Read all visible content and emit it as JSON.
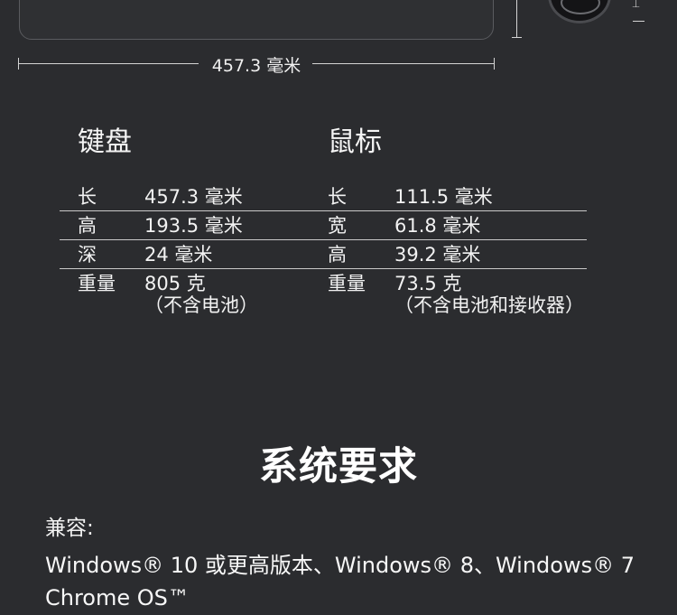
{
  "dimension": {
    "width_label": "457.3 毫米"
  },
  "keyboard": {
    "title": "键盘",
    "rows": [
      {
        "key": "长",
        "value": "457.3 毫米",
        "note": ""
      },
      {
        "key": "高",
        "value": "193.5 毫米",
        "note": ""
      },
      {
        "key": "深",
        "value": "24 毫米",
        "note": ""
      },
      {
        "key": "重量",
        "value": "805 克",
        "note": "（不含电池）"
      }
    ]
  },
  "mouse": {
    "title": "鼠标",
    "rows": [
      {
        "key": "长",
        "value": "111.5 毫米",
        "note": ""
      },
      {
        "key": "宽",
        "value": "61.8 毫米",
        "note": ""
      },
      {
        "key": "高",
        "value": "39.2 毫米",
        "note": ""
      },
      {
        "key": "重量",
        "value": "73.5 克",
        "note": "（不含电池和接收器）"
      }
    ]
  },
  "system_requirements": {
    "title": "系统要求",
    "compat_label": "兼容:",
    "line1": "Windows® 10 或更高版本、Windows® 8、Windows® 7",
    "line2": "Chrome OS™"
  }
}
